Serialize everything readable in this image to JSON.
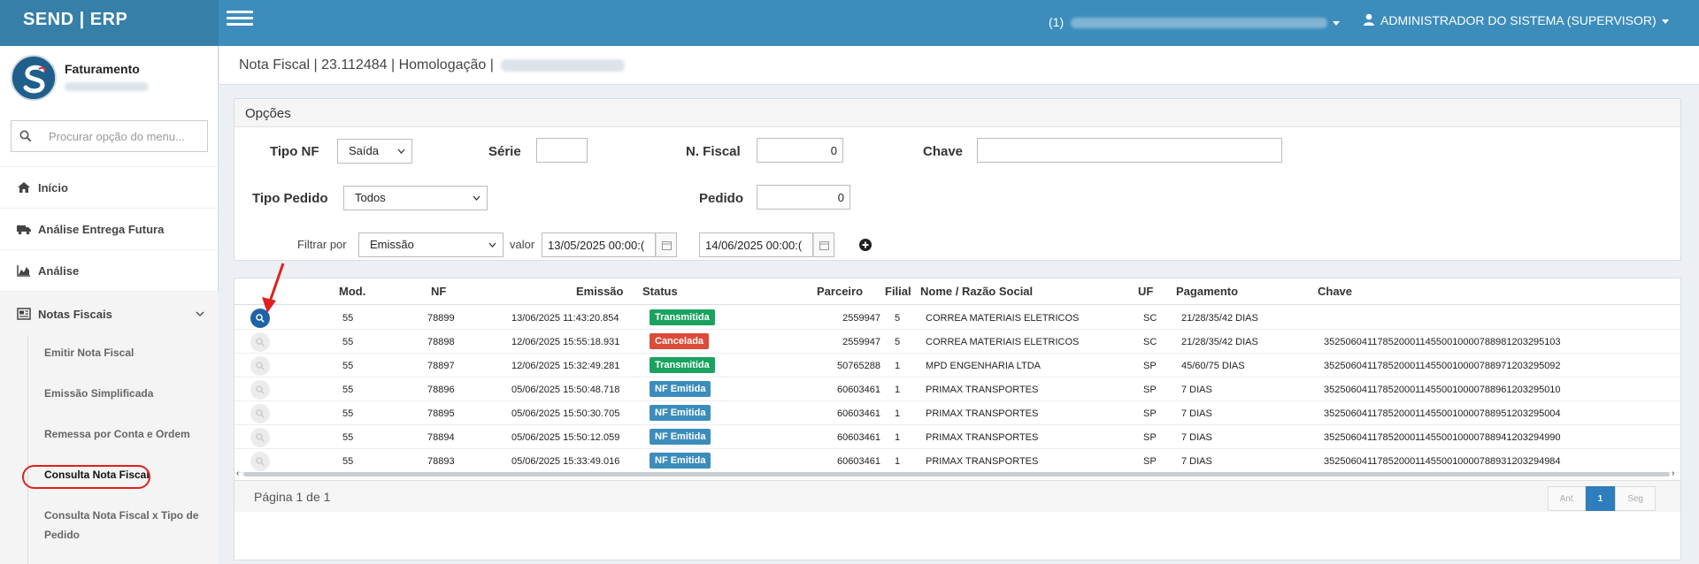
{
  "app": {
    "brand": "SEND | ERP"
  },
  "topbar": {
    "company_prefix": "(1)",
    "user_label": "ADMINISTRADOR DO SISTEMA (SUPERVISOR)"
  },
  "sidebar": {
    "profile_name": "Faturamento",
    "search_placeholder": "Procurar opção do menu...",
    "items": [
      {
        "label": "Início",
        "icon": "home-icon"
      },
      {
        "label": "Análise Entrega Futura",
        "icon": "truck-icon"
      },
      {
        "label": "Análise",
        "icon": "area-chart-icon"
      },
      {
        "label": "Notas Fiscais",
        "icon": "newspaper-icon"
      }
    ],
    "submenu": [
      {
        "label": "Emitir Nota Fiscal"
      },
      {
        "label": "Emissão Simplificada"
      },
      {
        "label": "Remessa por Conta e Ordem"
      },
      {
        "label": "Consulta Nota Fiscal"
      },
      {
        "label": "Consulta Nota Fiscal x Tipo de"
      },
      {
        "label": "Pedido"
      }
    ]
  },
  "header": {
    "title": "Nota Fiscal | 23.112484 | Homologação |"
  },
  "options": {
    "title": "Opções",
    "tipo_nf_label": "Tipo NF",
    "tipo_nf_value": "Saída",
    "serie_label": "Série",
    "serie_value": "",
    "nfiscal_label": "N. Fiscal",
    "nfiscal_value": "0",
    "chave_label": "Chave",
    "chave_value": "",
    "tipo_pedido_label": "Tipo Pedido",
    "tipo_pedido_value": "Todos",
    "pedido_label": "Pedido",
    "pedido_value": "0",
    "filtrar_label": "Filtrar por",
    "filtrar_value": "Emissão",
    "valor_label": "valor",
    "date_from": "13/05/2025 00:00:(",
    "date_to": "14/06/2025 00:00:("
  },
  "table": {
    "headers": {
      "mod": "Mod.",
      "nf": "NF",
      "emissao": "Emissão",
      "status": "Status",
      "parceiro": "Parceiro",
      "filial": "Filial",
      "nome": "Nome / Razão Social",
      "uf": "UF",
      "pagamento": "Pagamento",
      "chave": "Chave"
    },
    "rows": [
      {
        "mod": "55",
        "nf": "78899",
        "emissao": "13/06/2025 11:43:20.854",
        "status": "Transmitida",
        "status_color": "#1aa260",
        "parceiro": "2559947",
        "filial": "5",
        "nome": "CORREA MATERIAIS ELETRICOS",
        "uf": "SC",
        "pagamento": "21/28/35/42 DIAS",
        "chave": ""
      },
      {
        "mod": "55",
        "nf": "78898",
        "emissao": "12/06/2025 15:55:18.931",
        "status": "Cancelada",
        "status_color": "#dd4b39",
        "parceiro": "2559947",
        "filial": "5",
        "nome": "CORREA MATERIAIS ELETRICOS",
        "uf": "SC",
        "pagamento": "21/28/35/42 DIAS",
        "chave": "35250604117852000114550010000788981203295103"
      },
      {
        "mod": "55",
        "nf": "78897",
        "emissao": "12/06/2025 15:32:49.281",
        "status": "Transmitida",
        "status_color": "#1aa260",
        "parceiro": "50765288",
        "filial": "1",
        "nome": "MPD ENGENHARIA LTDA",
        "uf": "SP",
        "pagamento": "45/60/75 DIAS",
        "chave": "35250604117852000114550010000788971203295092"
      },
      {
        "mod": "55",
        "nf": "78896",
        "emissao": "05/06/2025 15:50:48.718",
        "status": "NF Emitida",
        "status_color": "#3c8dbc",
        "parceiro": "60603461",
        "filial": "1",
        "nome": "PRIMAX TRANSPORTES",
        "uf": "SP",
        "pagamento": "7 DIAS",
        "chave": "35250604117852000114550010000788961203295010"
      },
      {
        "mod": "55",
        "nf": "78895",
        "emissao": "05/06/2025 15:50:30.705",
        "status": "NF Emitida",
        "status_color": "#3c8dbc",
        "parceiro": "60603461",
        "filial": "1",
        "nome": "PRIMAX TRANSPORTES",
        "uf": "SP",
        "pagamento": "7 DIAS",
        "chave": "35250604117852000114550010000788951203295004"
      },
      {
        "mod": "55",
        "nf": "78894",
        "emissao": "05/06/2025 15:50:12.059",
        "status": "NF Emitida",
        "status_color": "#3c8dbc",
        "parceiro": "60603461",
        "filial": "1",
        "nome": "PRIMAX TRANSPORTES",
        "uf": "SP",
        "pagamento": "7 DIAS",
        "chave": "35250604117852000114550010000788941203294990"
      },
      {
        "mod": "55",
        "nf": "78893",
        "emissao": "05/06/2025 15:33:49.016",
        "status": "NF Emitida",
        "status_color": "#3c8dbc",
        "parceiro": "60603461",
        "filial": "1",
        "nome": "PRIMAX TRANSPORTES",
        "uf": "SP",
        "pagamento": "7 DIAS",
        "chave": "35250604117852000114550010000788931203294984"
      }
    ],
    "page_info": "Página 1 de 1",
    "pager": {
      "prev": "Ant",
      "current": "1",
      "next": "Seg"
    }
  },
  "colors": {
    "topbar": "#3c8dbc",
    "brand": "#367fa9",
    "active_circle": "#e02020",
    "annotation_arrow": "#e02020"
  }
}
